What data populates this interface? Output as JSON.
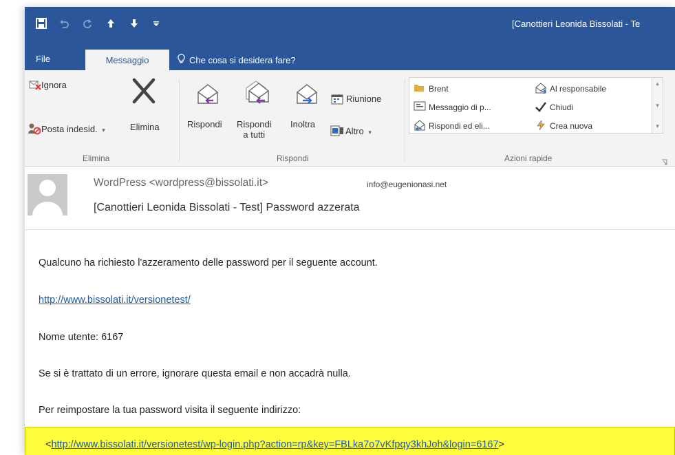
{
  "window": {
    "title": "[Canottieri Leonida Bissolati - Te"
  },
  "tabs": {
    "file": "File",
    "messaggio": "Messaggio",
    "tell_me": "Che cosa si desidera fare?"
  },
  "ribbon": {
    "elimina_group": {
      "ignora": "Ignora",
      "posta_indesiderata": "Posta indesid.",
      "elimina": "Elimina",
      "label": "Elimina"
    },
    "rispondi_group": {
      "rispondi": "Rispondi",
      "rispondi_a_tutti_line1": "Rispondi",
      "rispondi_a_tutti_line2": "a tutti",
      "inoltra": "Inoltra",
      "riunione": "Riunione",
      "altro": "Altro",
      "label": "Rispondi"
    },
    "azioni_rapide": {
      "items": [
        "Brent",
        "Al responsabile",
        "Messaggio di p...",
        "Chiudi",
        "Rispondi ed eli...",
        "Crea nuova"
      ],
      "label": "Azioni rapide"
    }
  },
  "message": {
    "sender": "WordPress <wordpress@bissolati.it>",
    "recipient": "info@eugenionasi.net",
    "subject": "[Canottieri Leonida Bissolati - Test] Password azzerata",
    "body": {
      "line1": "Qualcuno ha richiesto l'azzeramento delle password per il seguente account.",
      "site_link": "http://www.bissolati.it/versionetest/",
      "username": "Nome utente: 6167",
      "line_error": "Se si è trattato di un errore, ignorare questa email e non accadrà nulla.",
      "line_reset": "Per reimpostare la tua password visita il seguente indirizzo:",
      "reset_open": "<",
      "reset_link": "http://www.bissolati.it/versionetest/wp-login.php?action=rp&key=FBLka7o7vKfpqy3khJoh&login=6167",
      "reset_close": ">"
    }
  },
  "colors": {
    "brand": "#2b579a",
    "ribbon_bg": "#f3f3f3",
    "link": "#1f5aa6",
    "highlight": "#fdfd3a"
  },
  "icons": {
    "save": "save-icon",
    "undo": "undo-icon",
    "redo": "redo-icon",
    "up": "up-arrow-icon",
    "down": "down-arrow-icon",
    "customize": "customize-qat-icon",
    "lightbulb": "lightbulb-icon",
    "ignore": "ignore-icon",
    "junk": "junk-icon",
    "delete": "delete-x-icon",
    "reply": "reply-icon",
    "reply_all": "reply-all-icon",
    "forward": "forward-icon",
    "meeting": "meeting-icon",
    "more": "more-icon",
    "folder": "folder-icon",
    "manager": "to-manager-icon",
    "message": "message-icon",
    "check": "check-icon",
    "reply_delete": "reply-delete-icon",
    "create_new": "lightning-icon",
    "avatar": "person-avatar"
  }
}
